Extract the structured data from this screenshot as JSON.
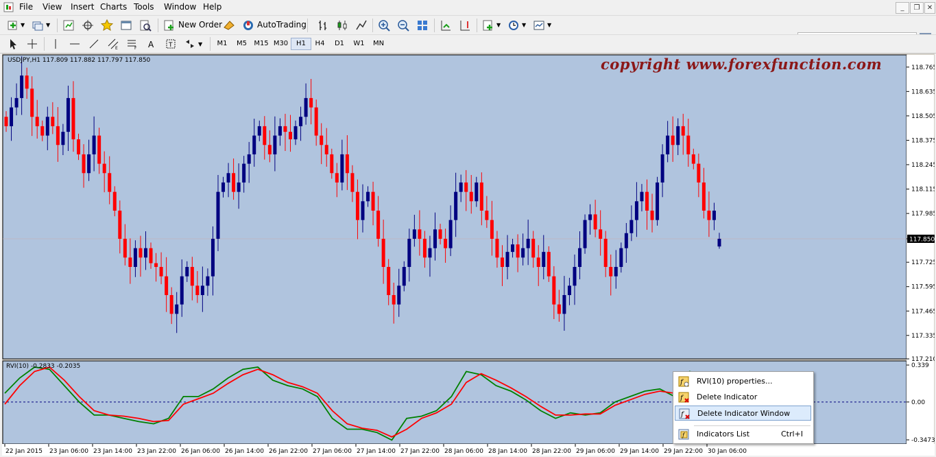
{
  "menu": [
    "File",
    "View",
    "Insert",
    "Charts",
    "Tools",
    "Window",
    "Help"
  ],
  "toolbar": {
    "new_order": "New Order",
    "autotrading": "AutoTrading",
    "badge": "5"
  },
  "timeframes": [
    {
      "label": "M1",
      "active": false
    },
    {
      "label": "M5",
      "active": false
    },
    {
      "label": "M15",
      "active": false
    },
    {
      "label": "M30",
      "active": false
    },
    {
      "label": "H1",
      "active": true
    },
    {
      "label": "H4",
      "active": false
    },
    {
      "label": "D1",
      "active": false
    },
    {
      "label": "W1",
      "active": false
    },
    {
      "label": "MN",
      "active": false
    }
  ],
  "chart": {
    "header": "USDJPY,H1  117.809 117.882 117.797 117.850",
    "watermark": "copyright www.forexfunction.com",
    "bg": "#b0c4de",
    "bull": "#000080",
    "bear": "#ff0000"
  },
  "indicator": {
    "header": "RVI(10) -0.2833 -0.2035",
    "line_main": "#008000",
    "line_signal": "#ff0000"
  },
  "context_menu": {
    "items": [
      {
        "label": "RVI(10) properties...",
        "shortcut": "",
        "icon": "properties-icon",
        "highlight": false
      },
      {
        "label": "Delete Indicator",
        "shortcut": "",
        "icon": "delete-indicator-icon",
        "highlight": false
      },
      {
        "label": "Delete Indicator Window",
        "shortcut": "",
        "icon": "delete-window-icon",
        "highlight": true
      },
      {
        "label": "Indicators List",
        "shortcut": "Ctrl+I",
        "icon": "indicators-list-icon",
        "highlight": false
      }
    ]
  },
  "chart_data": {
    "type": "candlestick",
    "symbol": "USDJPY",
    "timeframe": "H1",
    "last": {
      "open": 117.809,
      "high": 117.882,
      "low": 117.797,
      "close": 117.85
    },
    "price_label": "117.850",
    "ylim": [
      117.21,
      118.83
    ],
    "y_ticks": [
      "118.765",
      "118.635",
      "118.505",
      "118.375",
      "118.245",
      "118.115",
      "117.985",
      "117.850",
      "117.725",
      "117.595",
      "117.465",
      "117.335",
      "117.210"
    ],
    "x_ticks": [
      "22 Jan 2015",
      "23 Jan 06:00",
      "23 Jan 14:00",
      "23 Jan 22:00",
      "26 Jan 06:00",
      "26 Jan 14:00",
      "26 Jan 22:00",
      "27 Jan 06:00",
      "27 Jan 14:00",
      "27 Jan 22:00",
      "28 Jan 06:00",
      "28 Jan 14:00",
      "28 Jan 22:00",
      "29 Jan 06:00",
      "29 Jan 14:00",
      "29 Jan 22:00",
      "30 Jan 06:00"
    ],
    "closes": [
      118.45,
      118.55,
      118.6,
      118.72,
      118.65,
      118.5,
      118.45,
      118.4,
      118.5,
      118.45,
      118.35,
      118.42,
      118.6,
      118.38,
      118.3,
      118.2,
      118.3,
      118.4,
      118.25,
      118.2,
      118.1,
      118.0,
      117.85,
      117.75,
      117.7,
      117.8,
      117.75,
      117.8,
      117.72,
      117.7,
      117.65,
      117.55,
      117.45,
      117.5,
      117.65,
      117.7,
      117.6,
      117.55,
      117.6,
      117.65,
      117.85,
      118.1,
      118.15,
      118.2,
      118.1,
      118.15,
      118.25,
      118.3,
      118.4,
      118.45,
      118.35,
      118.3,
      118.4,
      118.45,
      118.42,
      118.38,
      118.45,
      118.5,
      118.6,
      118.55,
      118.4,
      118.35,
      118.3,
      118.2,
      118.15,
      118.3,
      118.2,
      118.1,
      117.95,
      118.05,
      118.1,
      118.0,
      117.85,
      117.7,
      117.55,
      117.5,
      117.6,
      117.7,
      117.85,
      117.9,
      117.85,
      117.75,
      117.8,
      117.9,
      117.85,
      117.8,
      117.95,
      118.1,
      118.15,
      118.1,
      118.05,
      118.15,
      118.0,
      117.95,
      117.85,
      117.75,
      117.7,
      117.78,
      117.82,
      117.75,
      117.8,
      117.85,
      117.75,
      117.7,
      117.78,
      117.65,
      117.5,
      117.45,
      117.55,
      117.6,
      117.7,
      117.8,
      117.95,
      117.98,
      117.9,
      117.85,
      117.7,
      117.65,
      117.7,
      117.8,
      117.88,
      117.95,
      118.05,
      118.1,
      118.0,
      117.95,
      118.15,
      118.3,
      118.4,
      118.35,
      118.45,
      118.4,
      118.3,
      118.25,
      118.15,
      118.0,
      117.95,
      118.0,
      117.85
    ]
  },
  "rvi_data": {
    "type": "line",
    "name": "RVI(10)",
    "values": [
      -0.2833,
      -0.2035
    ],
    "ylim": [
      -0.3473,
      0.339
    ],
    "y_ticks": [
      "0.339",
      "0.00",
      "-0.3473"
    ],
    "main": [
      0.08,
      0.22,
      0.32,
      0.3,
      0.15,
      0.0,
      -0.12,
      -0.12,
      -0.15,
      -0.18,
      -0.2,
      -0.15,
      0.05,
      0.05,
      0.12,
      0.22,
      0.3,
      0.32,
      0.2,
      0.15,
      0.12,
      0.05,
      -0.15,
      -0.25,
      -0.25,
      -0.28,
      -0.35,
      -0.15,
      -0.13,
      -0.08,
      0.05,
      0.28,
      0.25,
      0.15,
      0.1,
      0.02,
      -0.08,
      -0.15,
      -0.1,
      -0.12,
      -0.1,
      0.0,
      0.05,
      0.1,
      0.12,
      0.05,
      0.28,
      0.25,
      0.22
    ],
    "signal": [
      -0.02,
      0.15,
      0.28,
      0.32,
      0.2,
      0.05,
      -0.08,
      -0.12,
      -0.13,
      -0.15,
      -0.18,
      -0.17,
      -0.02,
      0.03,
      0.08,
      0.17,
      0.25,
      0.3,
      0.25,
      0.18,
      0.14,
      0.08,
      -0.08,
      -0.2,
      -0.24,
      -0.26,
      -0.32,
      -0.25,
      -0.15,
      -0.1,
      -0.02,
      0.18,
      0.26,
      0.2,
      0.13,
      0.05,
      -0.04,
      -0.12,
      -0.12,
      -0.11,
      -0.11,
      -0.03,
      0.02,
      0.07,
      0.1,
      0.08,
      0.18,
      0.24,
      0.23
    ]
  }
}
